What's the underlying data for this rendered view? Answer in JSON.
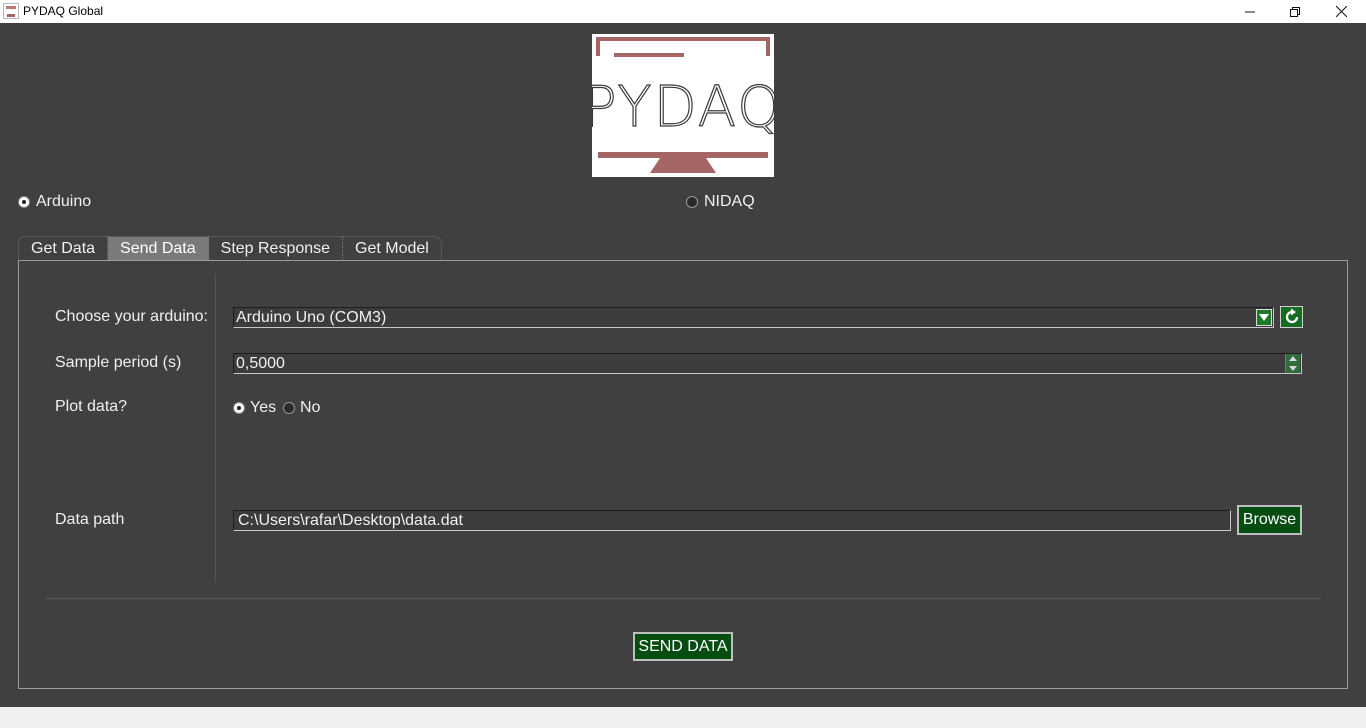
{
  "window": {
    "title": "PYDAQ Global"
  },
  "logo": {
    "text": "PYDAQ",
    "colors": {
      "frame": "#a56565",
      "text": "#3a3a3a"
    }
  },
  "devices": {
    "arduino_label": "Arduino",
    "nidaq_label": "NIDAQ",
    "selected": "Arduino"
  },
  "tabs": [
    {
      "label": "Get Data",
      "active": false
    },
    {
      "label": "Send Data",
      "active": true
    },
    {
      "label": "Step Response",
      "active": false
    },
    {
      "label": "Get Model",
      "active": false
    }
  ],
  "form": {
    "choose_label": "Choose your arduino:",
    "choose_value": "Arduino Uno (COM3)",
    "sample_label": "Sample period (s)",
    "sample_value": "0,5000",
    "plot_label": "Plot data?",
    "plot_yes": "Yes",
    "plot_no": "No",
    "plot_selected": "Yes",
    "path_label": "Data path",
    "path_value": "C:\\Users\\rafar\\Desktop\\data.dat",
    "browse_label": "Browse",
    "send_label": "SEND DATA"
  },
  "icons": {
    "refresh": "refresh-icon",
    "dropdown": "chevron-down-icon",
    "spin_up": "caret-up-icon",
    "spin_down": "caret-down-icon"
  },
  "colors": {
    "background": "#404040",
    "accent_green": "#064d12",
    "text": "#f0f0f0"
  }
}
